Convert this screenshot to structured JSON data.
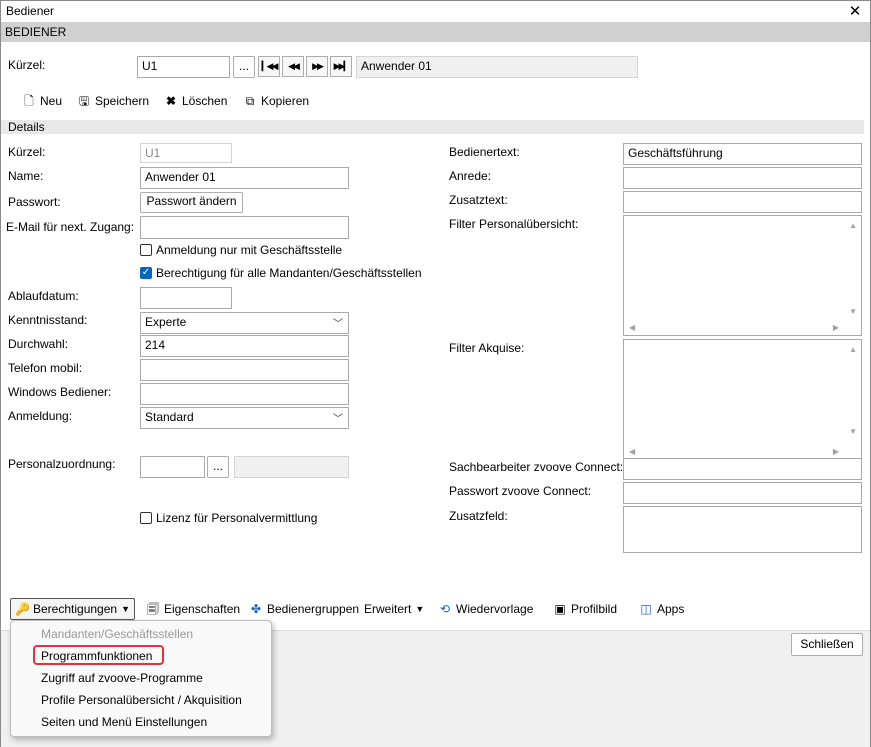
{
  "window": {
    "title": "Bediener",
    "section": "BEDIENER"
  },
  "top": {
    "kuerzel_label": "Kürzel:",
    "kuerzel_value": "U1",
    "browse": "...",
    "name_display": "Anwender 01"
  },
  "toolbar": {
    "neu": "Neu",
    "speichern": "Speichern",
    "loeschen": "Löschen",
    "kopieren": "Kopieren"
  },
  "details": {
    "header": "Details",
    "kuerzel_label": "Kürzel:",
    "kuerzel_value": "U1",
    "name_label": "Name:",
    "name_value": "Anwender 01",
    "passwort_label": "Passwort:",
    "passwort_button": "Passwort ändern",
    "email_label": "E-Mail für next. Zugang:",
    "email_value": "",
    "chk_geschaeftsstelle": "Anmeldung nur mit Geschäftsstelle",
    "chk_berechtigung": "Berechtigung für alle Mandanten/Geschäftsstellen",
    "ablaufdatum_label": "Ablaufdatum:",
    "ablaufdatum_value": "",
    "kenntnisstand_label": "Kenntnisstand:",
    "kenntnisstand_value": "Experte",
    "durchwahl_label": "Durchwahl:",
    "durchwahl_value": "214",
    "telefon_label": "Telefon mobil:",
    "telefon_value": "",
    "windows_label": "Windows Bediener:",
    "windows_value": "",
    "anmeldung_label": "Anmeldung:",
    "anmeldung_value": "Standard",
    "personal_label": "Personalzuordnung:",
    "personal_browse": "...",
    "chk_lizenz": "Lizenz für Personalvermittlung",
    "bedienertext_label": "Bedienertext:",
    "bedienertext_value": "Geschäftsführung",
    "anrede_label": "Anrede:",
    "anrede_value": "",
    "zusatztext_label": "Zusatztext:",
    "zusatztext_value": "",
    "filter_personal_label": "Filter Personalübersicht:",
    "filter_akquise_label": "Filter Akquise:",
    "sachbearbeiter_label": "Sachbearbeiter zvoove Connect:",
    "sachbearbeiter_value": "",
    "passwort_connect_label": "Passwort zvoove Connect:",
    "passwort_connect_value": "",
    "zusatzfeld_label": "Zusatzfeld:"
  },
  "bottom_toolbar": {
    "berechtigungen": "Berechtigungen",
    "eigenschaften": "Eigenschaften",
    "bedienergruppen": "Bedienergruppen",
    "erweitert": "Erweitert",
    "wiedervorlage": "Wiedervorlage",
    "profilbild": "Profilbild",
    "apps": "Apps"
  },
  "menu": {
    "items": [
      {
        "label": "Mandanten/Geschäftsstellen",
        "enabled": false
      },
      {
        "label": "Programmfunktionen",
        "enabled": true,
        "highlighted": true
      },
      {
        "label": "Zugriff auf zvoove-Programme",
        "enabled": true
      },
      {
        "label": "Profile Personalübersicht / Akquisition",
        "enabled": true
      },
      {
        "label": "Seiten und Menü Einstellungen",
        "enabled": true
      }
    ]
  },
  "footer": {
    "close_button": "Schließen"
  },
  "icons": {
    "close": "close-icon",
    "first": "first-record-icon",
    "prev": "previous-record-icon",
    "next": "next-record-icon",
    "last": "last-record-icon",
    "neu": "new-document-icon",
    "speichern": "save-icon",
    "loeschen": "delete-icon",
    "kopieren": "copy-icon",
    "berechtigungen": "key-icon",
    "eigenschaften": "properties-icon",
    "bedienergruppen": "group-icon",
    "wiedervorlage": "resubmission-icon",
    "profilbild": "profile-picture-icon",
    "apps": "apps-icon"
  },
  "colors": {
    "highlight_border": "#e0343a",
    "checkbox_on": "#0067c0",
    "section_bg": "#d0d0d0"
  }
}
